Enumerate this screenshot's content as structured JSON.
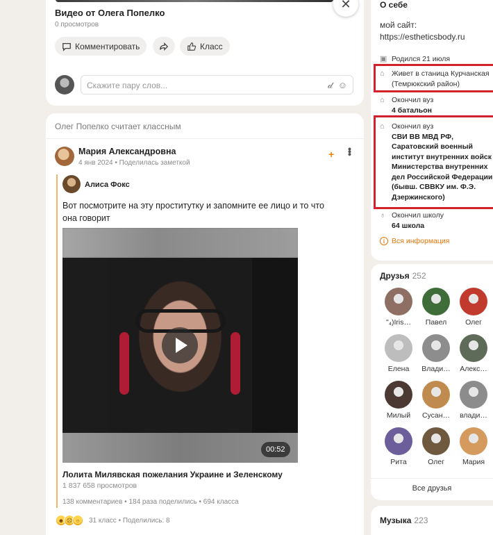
{
  "video_post": {
    "title": "Видео от Олега Попелко",
    "views": "0 просмотров",
    "comment_label": "Комментировать",
    "class_label": "Класс",
    "comment_placeholder": "Скажите пару слов..."
  },
  "feed_post": {
    "liked_header": "Олег Попелко считает классным",
    "author": "Мария Александровна",
    "meta": "4 янв 2024 • Поделилась заметкой",
    "quoted_author": "Алиса Фокс",
    "text": "Вот посмотрите на эту проститутку и запомните ее лицо и то что она говорит",
    "video_duration": "00:52",
    "video_title": "Лолита Милявская пожелания Украине и Зеленскому",
    "video_views": "1 837 658 просмотров",
    "stats": "138 комментариев  •  184 раза поделились  •  694 класса",
    "reactions_text": "31 класс  •  Поделились: 8"
  },
  "about": {
    "title": "О себе",
    "site_label": "мой сайт:",
    "site": "https://estheticsbody.ru",
    "born": "Родился 21 июля",
    "lives": "Живет в станица Курчанская (Темрюкский район)",
    "uni1_label": "Окончил вуз",
    "uni1_name": "4 батальон",
    "uni2_label": "Окончил вуз",
    "uni2_name": "СВИ ВВ МВД РФ, Саратовский военный институт внутренних войск Министерства внутренних дел Российской Федерации (бывш. СВВКУ им. Ф.Э. Дзержинского)",
    "school_label": "Окончил школу",
    "school_name": "64 школа",
    "all_info": "Вся информация"
  },
  "friends": {
    "title": "Друзья",
    "count": "252",
    "all_label": "Все друзья",
    "items": [
      {
        "name": "\"₄)Iris…",
        "color": "#8f6e63"
      },
      {
        "name": "Павел",
        "color": "#3f6d3a"
      },
      {
        "name": "Олег",
        "color": "#c23a2e"
      },
      {
        "name": "Елена",
        "color": "#bdbdbd"
      },
      {
        "name": "Влади…",
        "color": "#8d8d8d"
      },
      {
        "name": "Алекс…",
        "color": "#5f6b59"
      },
      {
        "name": "Милый",
        "color": "#4a3a33"
      },
      {
        "name": "Сусан…",
        "color": "#c08b4e"
      },
      {
        "name": "влади…",
        "color": "#8c8c8c"
      },
      {
        "name": "Рита",
        "color": "#6b5e9a"
      },
      {
        "name": "Олег",
        "color": "#6f5a40"
      },
      {
        "name": "Мария",
        "color": "#d49a5e"
      }
    ]
  },
  "music": {
    "title": "Музыка",
    "count": "223"
  }
}
